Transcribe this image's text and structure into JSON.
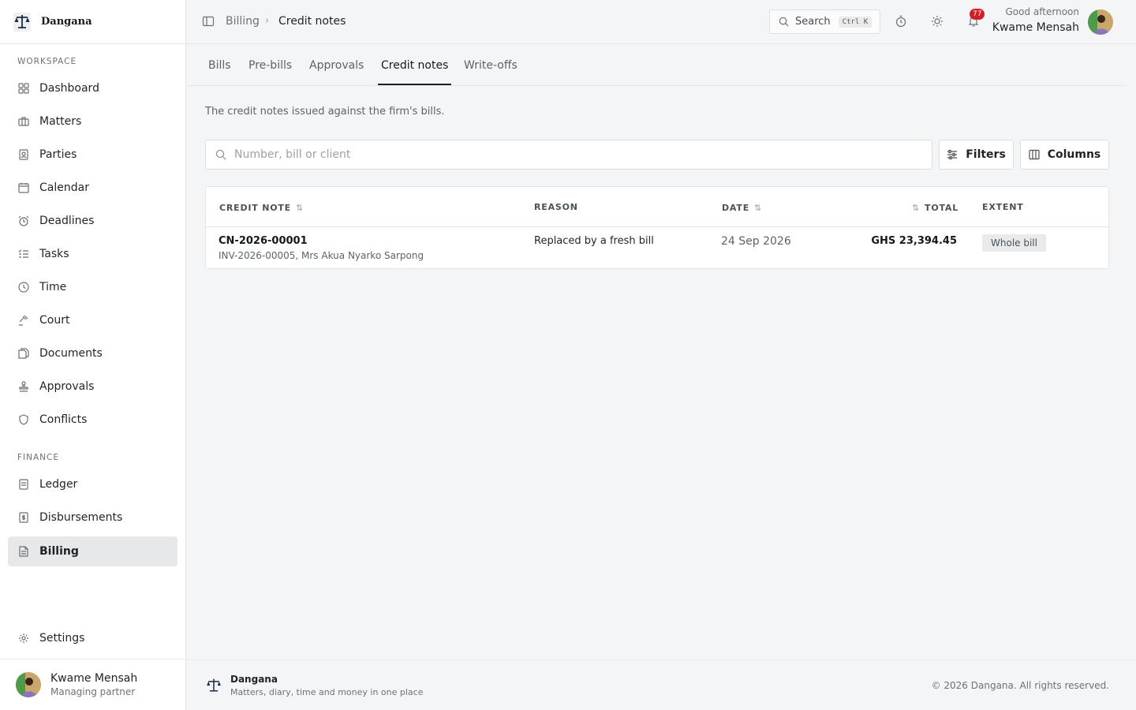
{
  "brand": {
    "name": "Dangana"
  },
  "sidebar": {
    "workspace_title": "WORKSPACE",
    "finance_title": "FINANCE",
    "workspace_items": [
      {
        "label": "Dashboard",
        "icon": "dashboard-icon"
      },
      {
        "label": "Matters",
        "icon": "briefcase-icon"
      },
      {
        "label": "Parties",
        "icon": "contact-icon"
      },
      {
        "label": "Calendar",
        "icon": "calendar-icon"
      },
      {
        "label": "Deadlines",
        "icon": "alarm-icon"
      },
      {
        "label": "Tasks",
        "icon": "checklist-icon"
      },
      {
        "label": "Time",
        "icon": "clock-icon"
      },
      {
        "label": "Court",
        "icon": "gavel-icon"
      },
      {
        "label": "Documents",
        "icon": "documents-icon"
      },
      {
        "label": "Approvals",
        "icon": "stamp-icon"
      },
      {
        "label": "Conflicts",
        "icon": "shield-icon"
      }
    ],
    "finance_items": [
      {
        "label": "Ledger",
        "icon": "ledger-icon"
      },
      {
        "label": "Disbursements",
        "icon": "receipt-icon"
      },
      {
        "label": "Billing",
        "icon": "bill-icon",
        "active": true
      }
    ],
    "settings_label": "Settings",
    "user": {
      "name": "Kwame Mensah",
      "role": "Managing partner"
    }
  },
  "topbar": {
    "breadcrumb": [
      "Billing",
      "Credit notes"
    ],
    "search_label": "Search",
    "search_shortcut": "Ctrl K",
    "notification_count": "77",
    "greeting": "Good afternoon",
    "user_name": "Kwame Mensah"
  },
  "tabs": [
    {
      "label": "Bills"
    },
    {
      "label": "Pre-bills"
    },
    {
      "label": "Approvals"
    },
    {
      "label": "Credit notes",
      "active": true
    },
    {
      "label": "Write-offs"
    }
  ],
  "main": {
    "description": "The credit notes issued against the firm's bills.",
    "search_placeholder": "Number, bill or client",
    "filters_label": "Filters",
    "columns_label": "Columns"
  },
  "table": {
    "headers": {
      "credit_note": "CREDIT NOTE",
      "reason": "REASON",
      "date": "DATE",
      "total": "TOTAL",
      "extent": "EXTENT"
    },
    "rows": [
      {
        "number": "CN-2026-00001",
        "subline": "INV-2026-00005, Mrs Akua Nyarko Sarpong",
        "reason": "Replaced by a fresh bill",
        "date": "24 Sep 2026",
        "total": "GHS 23,394.45",
        "extent": "Whole bill"
      }
    ]
  },
  "footer": {
    "name": "Dangana",
    "tagline": "Matters, diary, time and money in one place",
    "copyright": "© 2026 Dangana. All rights reserved."
  },
  "colors": {
    "accent": "#1f2328",
    "badge": "#d21f27",
    "active_nav_bg": "#e6e8ea",
    "page_bg": "#f4f5f6"
  }
}
